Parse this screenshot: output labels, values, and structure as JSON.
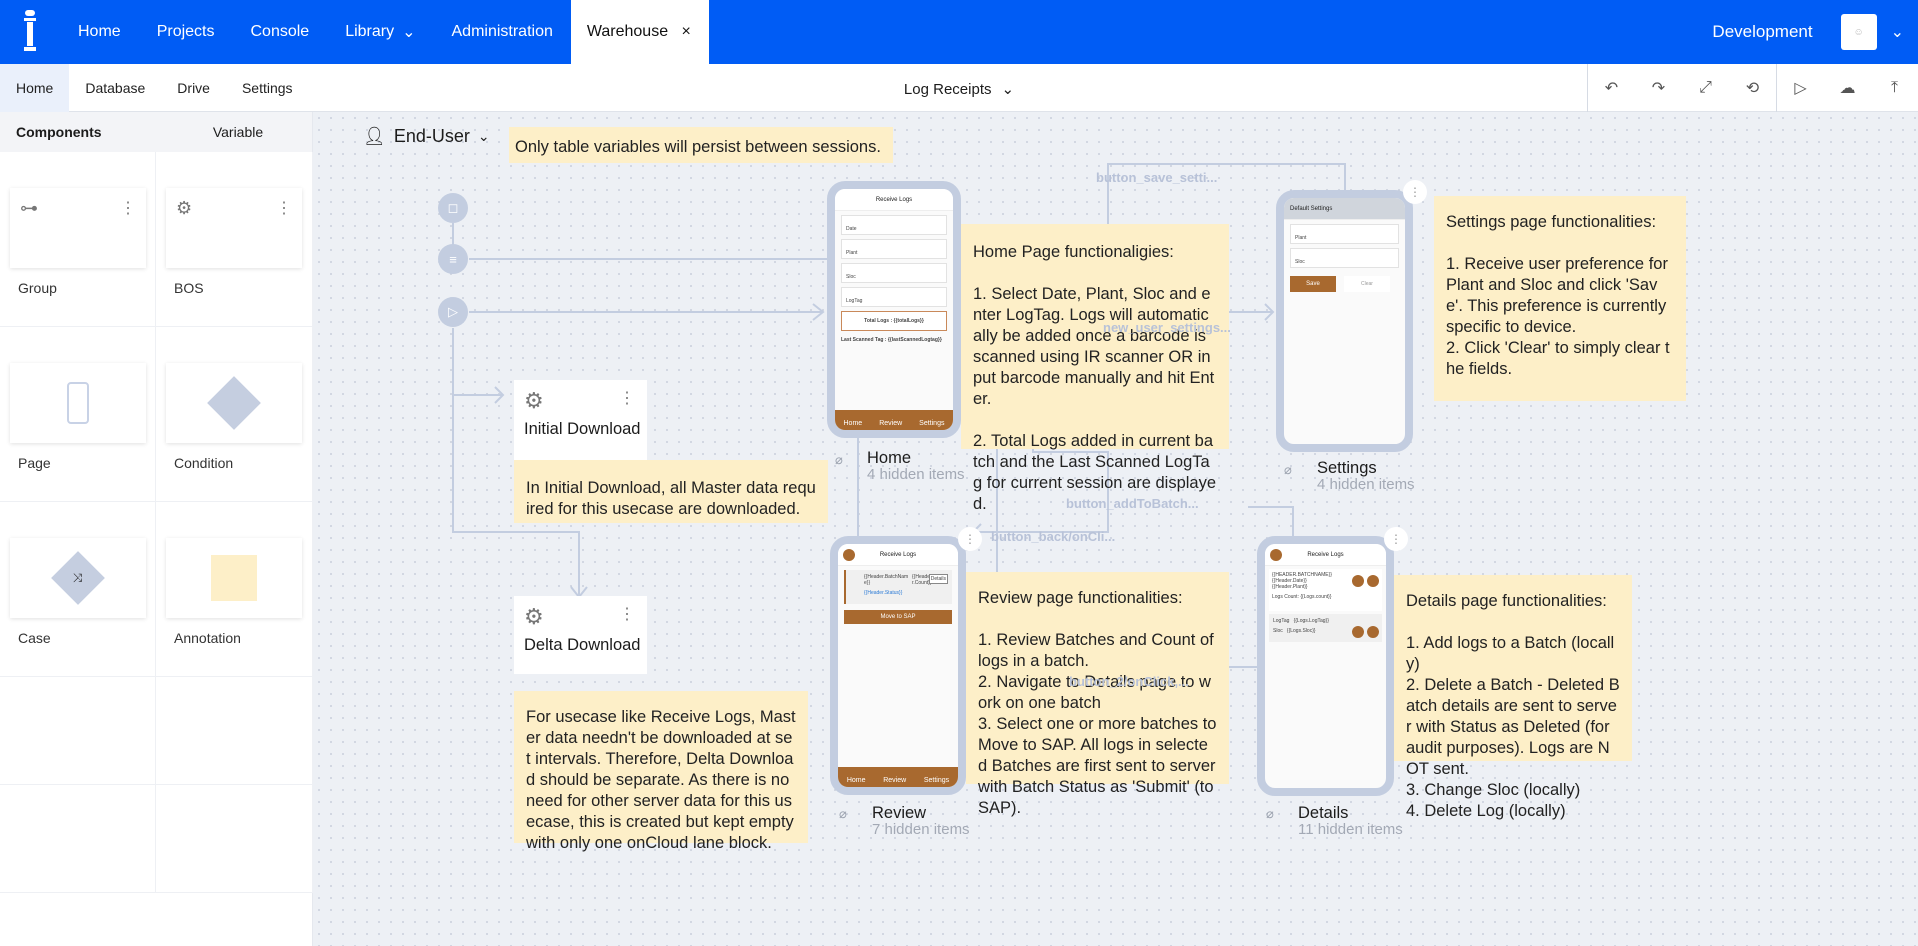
{
  "topbar": {
    "nav": [
      "Home",
      "Projects",
      "Console",
      "Library",
      "Administration"
    ],
    "active_tab": "Warehouse",
    "close": "×",
    "environment": "Development",
    "brand_color": "#005cf5"
  },
  "subbar": {
    "tabs": [
      "Home",
      "Database",
      "Drive",
      "Settings"
    ],
    "app": "Log Receipts"
  },
  "left": {
    "tabs": [
      "Components",
      "Variable"
    ],
    "items": [
      "Group",
      "BOS",
      "Page",
      "Condition",
      "Case",
      "Annotation"
    ]
  },
  "canvas": {
    "user": "End-User",
    "note_top": "Only table variables will persist between sessions.",
    "initial_download": "Initial Download",
    "initial_note": "In Initial Download, all Master data required for this usecase are downloaded.",
    "delta_download": "Delta Download",
    "delta_note": "For usecase like Receive Logs, Master data needn't be downloaded at set intervals. Therefore, Delta Download should be separate. As there is no need for other server data for this usecase, this is created but kept empty with only one onCloud lane block.",
    "home_note": "Home Page functionaligies:\n\n1. Select Date, Plant, Sloc and enter LogTag. Logs will automatically be added once a barcode is scanned using IR scanner OR input barcode manually and hit Enter.\n\n2. Total Logs added in current batch and the Last Scanned LogTag for current session are displayed.",
    "settings_note": "Settings page functionalities:\n\n1. Receive user preference for Plant and Sloc and click 'Save'. This preference is currently specific to device.\n2. Click 'Clear' to simply clear the fields.",
    "review_note": "Review page functionalities:\n\n1. Review Batches and Count of logs in a batch.\n2. Navigate to Details page to work on one batch\n3. Select one or more batches to Move to SAP. All logs in selected Batches are first sent to server with Batch Status as 'Submit' (to SAP).",
    "details_note": "Details page functionalities:\n\n1. Add logs to a Batch (locally)\n2. Delete a Batch - Deleted Batch details are sent to server with Status as Deleted (for audit purposes). Logs are NOT sent.\n3. Change Sloc (locally)\n4. Delete Log (locally)",
    "edges": [
      "button_save_setti...",
      "new_user_settings...",
      "button_addToBatch...",
      "button_back/onCli...",
      "button_2/onClick,..."
    ],
    "pages": [
      {
        "name": "Home",
        "hidden": "4 hidden items"
      },
      {
        "name": "Settings",
        "hidden": "4 hidden items"
      },
      {
        "name": "Review",
        "hidden": "7 hidden items"
      },
      {
        "name": "Details",
        "hidden": "11 hidden items"
      }
    ],
    "mock": {
      "receive_logs": "Receive Logs",
      "default_settings": "Default Settings",
      "plant": "Plant",
      "sloc": "Sloc",
      "date": "Date",
      "logtag": "LogTag",
      "total_logs": "Total Logs : {{totalLogs}}",
      "last_scanned": "Last Scanned Tag :   {{lastScannedLogtag}}",
      "save": "Save",
      "clear": "Clear",
      "move_to_sap": "Move to SAP",
      "details": "Details",
      "batch_name": "{{Header.BatchName}}",
      "batch_status": "{{Header.Status}}",
      "count": "{{Header.Count}}",
      "header_batchname": "{{HEADER.BATCHNAME}}",
      "header_date": "{{Header.Date}}",
      "header_plant": "{{Header.Plant}}",
      "logs_count": "Logs Count:   {{Logs.count}}",
      "log_tag": "{{Logs.LogTag}}",
      "log_sloc": "{{Logs.Sloc}}",
      "nav": [
        "Home",
        "Review",
        "Settings"
      ]
    }
  }
}
